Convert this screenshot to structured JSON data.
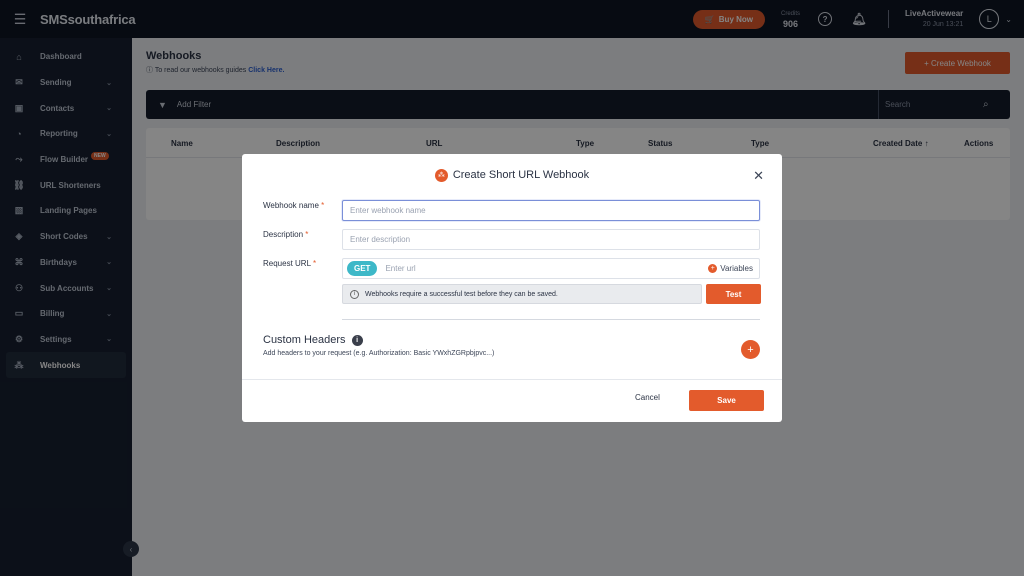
{
  "topbar": {
    "brand": "SMSsouthafrica",
    "buy_label": "Buy Now",
    "credits_label": "Credits",
    "credits_value": "906",
    "help_icon": "question-circle-icon",
    "bell_icon": "bell-icon",
    "user_name": "LiveActivewear",
    "user_date": "20 Jun 13:21",
    "avatar_letter": "L"
  },
  "sidebar": {
    "items": [
      {
        "label": "Dashboard",
        "icon": "home-icon"
      },
      {
        "label": "Sending",
        "icon": "envelope-icon"
      },
      {
        "label": "Contacts",
        "icon": "contacts-icon"
      },
      {
        "label": "Reporting",
        "icon": "pie-chart-icon"
      },
      {
        "label": "Flow Builder",
        "icon": "flow-icon",
        "badge": "NEW"
      },
      {
        "label": "URL Shorteners",
        "icon": "link-icon"
      },
      {
        "label": "Landing Pages",
        "icon": "image-icon"
      },
      {
        "label": "Short Codes",
        "icon": "short-code-icon"
      },
      {
        "label": "Birthdays",
        "icon": "cake-icon"
      },
      {
        "label": "Sub Accounts",
        "icon": "users-icon"
      },
      {
        "label": "Billing",
        "icon": "card-icon"
      },
      {
        "label": "Settings",
        "icon": "gear-icon"
      },
      {
        "label": "Webhooks",
        "icon": "webhook-icon"
      }
    ]
  },
  "page": {
    "title": "Webhooks",
    "subtitle_prefix": "To read our webhooks guides",
    "subtitle_link": "Click Here.",
    "create_label": "+ Create Webhook",
    "filter_label": "Add Filter",
    "search_placeholder": "Search",
    "columns": [
      "Name",
      "Description",
      "URL",
      "Type",
      "Status",
      "Type",
      "Created Date ↑",
      "Actions"
    ]
  },
  "modal": {
    "title": "Create Short URL Webhook",
    "fields": {
      "name_label": "Webhook name",
      "name_placeholder": "Enter webhook name",
      "desc_label": "Description",
      "desc_placeholder": "Enter description",
      "url_label": "Request URL",
      "method": "GET",
      "url_placeholder": "Enter url",
      "variables_label": "Variables"
    },
    "notice": "Webhooks require a successful test before they can be saved.",
    "test_label": "Test",
    "custom_headers_title": "Custom Headers",
    "custom_headers_sub": "Add headers to your request (e.g. Authorization: Basic YWxhZGRpbjpvc...)",
    "cancel_label": "Cancel",
    "save_label": "Save"
  },
  "colors": {
    "accent": "#e35b2c",
    "sidebar_bg": "#172030",
    "topbar_bg": "#0f1624",
    "get_pill": "#3db8c8"
  }
}
